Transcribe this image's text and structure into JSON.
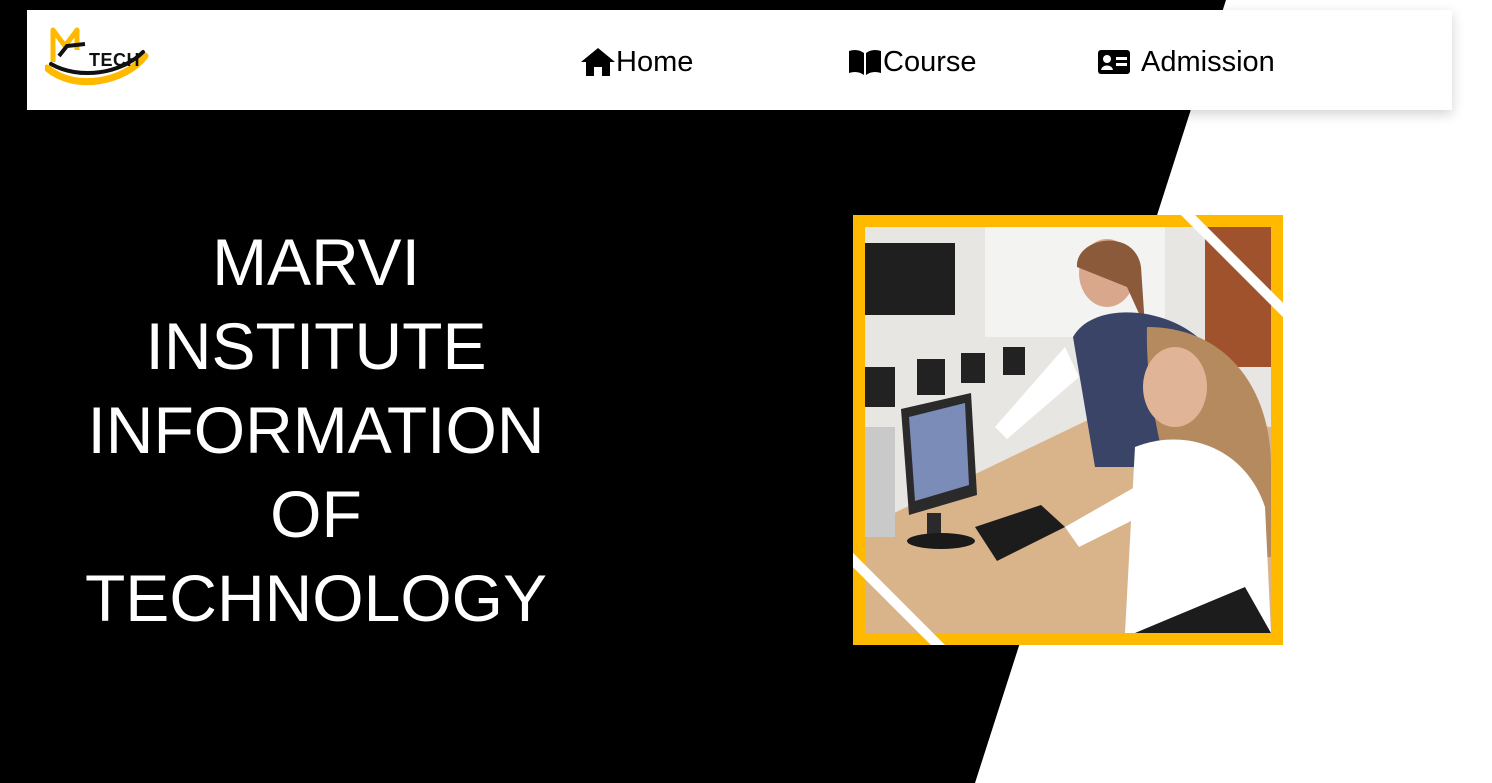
{
  "brand": {
    "logo_text": "TECH",
    "logo_mark": "M",
    "colors": {
      "accent": "#ffba00",
      "dark": "#000000"
    }
  },
  "nav": {
    "items": [
      {
        "label": "Home",
        "icon": "home-icon"
      },
      {
        "label": "Course",
        "icon": "book-icon"
      },
      {
        "label": "Admission",
        "icon": "id-card-icon"
      }
    ]
  },
  "hero": {
    "title_lines": [
      "MARVI",
      "INSTITUTE",
      "INFORMATION",
      "OF",
      "TECHNOLOGY"
    ],
    "image_alt": "Two students working at a computer in a classroom"
  }
}
